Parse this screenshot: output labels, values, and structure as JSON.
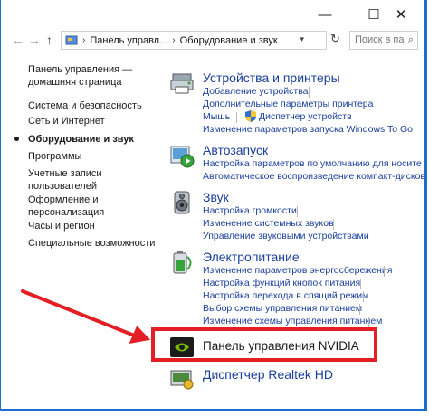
{
  "window": {
    "minimize": "—",
    "maximize": "☐",
    "close": "✕"
  },
  "nav": {
    "back": "←",
    "forward": "→",
    "up": "↑",
    "breadcrumb": [
      "Панель управл...",
      "Оборудование и звук"
    ],
    "search_placeholder": "Поиск в па"
  },
  "sidebar": {
    "items": [
      {
        "line1": "Панель управления —",
        "line2": "домашняя страница"
      },
      {
        "line1": "Система и безопасность"
      },
      {
        "line1": "Сеть и Интернет"
      },
      {
        "line1": "Оборудование и звук",
        "active": true
      },
      {
        "line1": "Программы"
      },
      {
        "line1": "Учетные записи",
        "line2": "пользователей"
      },
      {
        "line1": "Оформление и",
        "line2": "персонализация"
      },
      {
        "line1": "Часы и регион"
      },
      {
        "line1": "Специальные возможности"
      }
    ]
  },
  "categories": {
    "devices": {
      "title": "Устройства и принтеры",
      "links": [
        "Добавление устройства",
        "Дополнительные параметры принтера",
        "Мышь",
        "Диспетчер устройств",
        "Изменение параметров запуска Windows To Go"
      ]
    },
    "autoplay": {
      "title": "Автозапуск",
      "links": [
        "Настройка параметров по умолчанию для носите",
        "Автоматическое воспроизведение компакт-дисков"
      ]
    },
    "sound": {
      "title": "Звук",
      "links": [
        "Настройка громкости",
        "Изменение системных звуков",
        "Управление звуковыми устройствами"
      ]
    },
    "power": {
      "title": "Электропитание",
      "links": [
        "Изменение параметров энергосбережения",
        "Настройка функций кнопок питания",
        "Настройка перехода в спящий режим",
        "Выбор схемы управления питанием",
        "Изменение схемы управления питанием"
      ]
    },
    "nvidia": {
      "title": "Панель управления NVIDIA"
    },
    "realtek": {
      "title": "Диспетчер Realtek HD"
    }
  },
  "colors": {
    "link": "#1a3f9c",
    "highlight": "#e31e24",
    "frame": "#1a6fd0"
  }
}
